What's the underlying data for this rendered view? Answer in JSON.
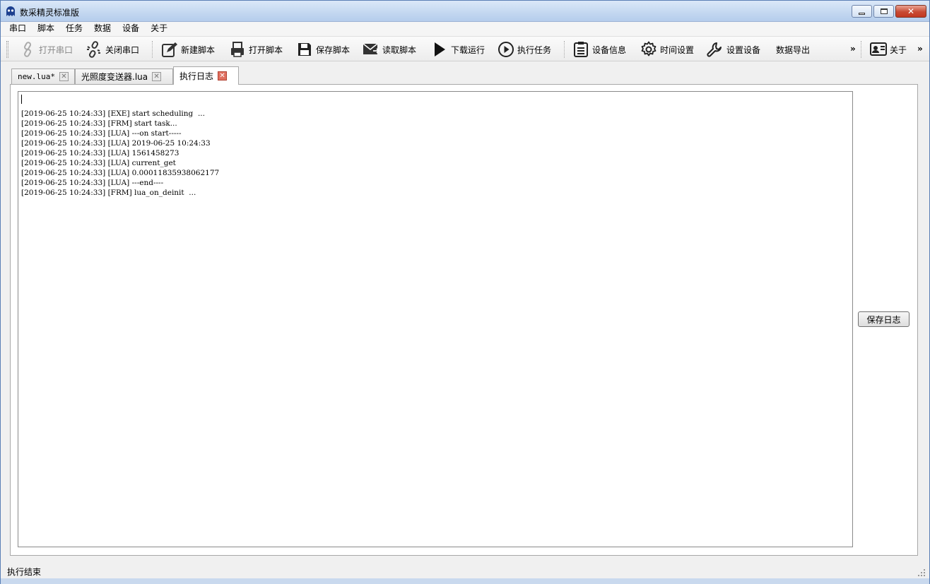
{
  "window": {
    "title": "数采精灵标准版"
  },
  "menu": [
    "串口",
    "脚本",
    "任务",
    "数据",
    "设备",
    "关于"
  ],
  "toolbar": {
    "open_port": "打开串口",
    "close_port": "关闭串口",
    "new_script": "新建脚本",
    "open_script": "打开脚本",
    "save_script": "保存脚本",
    "read_script": "读取脚本",
    "download_run": "下载运行",
    "run_task": "执行任务",
    "device_info": "设备信息",
    "time_settings": "时间设置",
    "set_device": "设置设备",
    "data_export": "数据导出",
    "overflow": "»",
    "about": "关于",
    "overflow2": "»"
  },
  "tabs": [
    {
      "label": "new.lua*",
      "close": "✕"
    },
    {
      "label": "光照度变送器.lua",
      "close": "✕"
    },
    {
      "label": "执行日志",
      "close": "✕"
    }
  ],
  "log": {
    "lines": [
      "[2019-06-25 10:24:33] [EXE] start scheduling  ...",
      "[2019-06-25 10:24:33] [FRM] start task...",
      "[2019-06-25 10:24:33] [LUA] ---on start-----",
      "[2019-06-25 10:24:33] [LUA] 2019-06-25 10:24:33",
      "[2019-06-25 10:24:33] [LUA] 1561458273",
      "[2019-06-25 10:24:33] [LUA] current_get",
      "[2019-06-25 10:24:33] [LUA] 0.00011835938062177",
      "[2019-06-25 10:24:33] [LUA] ---end----",
      "[2019-06-25 10:24:33] [FRM] lua_on_deinit  ..."
    ],
    "save_label": "保存日志"
  },
  "status": {
    "text": "执行结束"
  }
}
